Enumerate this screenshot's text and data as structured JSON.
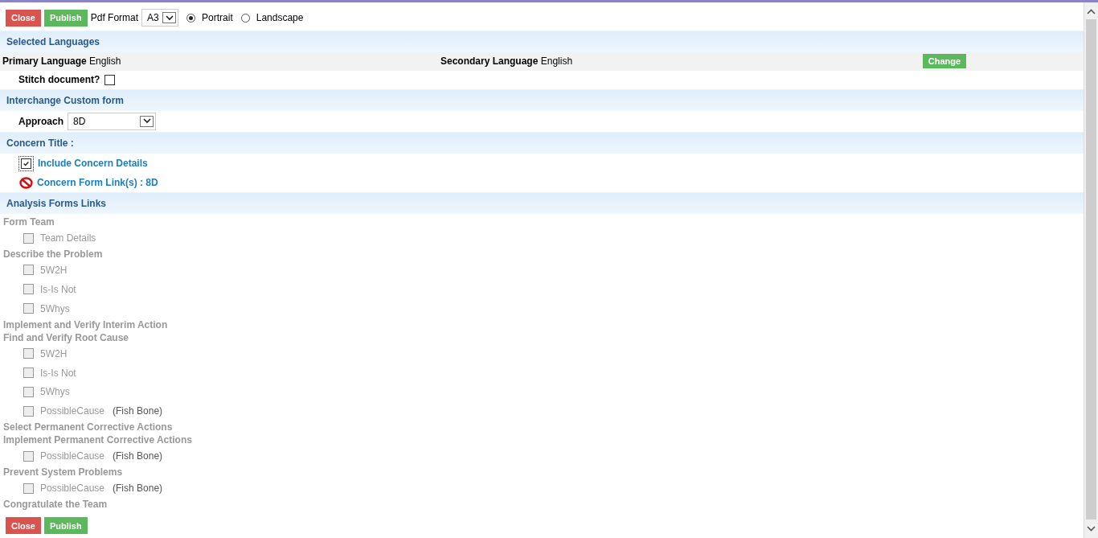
{
  "top_toolbar": {
    "buttons": [
      {
        "kind": "close",
        "label": "Close"
      },
      {
        "kind": "publish",
        "label": "Publish"
      }
    ],
    "pdf_format_label": "Pdf Format",
    "pdf_format_value": "A3",
    "orientation": [
      {
        "label": "Portrait",
        "selected": true
      },
      {
        "label": "Landscape",
        "selected": false
      }
    ]
  },
  "selected_languages": {
    "heading": "Selected Languages",
    "primary_label": "Primary Language",
    "primary_value": "English",
    "secondary_label": "Secondary Language",
    "secondary_value": "English",
    "change_button": "Change",
    "stitch_label": "Stitch document?",
    "stitch_checked": false
  },
  "interchange": {
    "heading": "Interchange Custom form",
    "approach_label": "Approach",
    "approach_value": "8D"
  },
  "concern": {
    "heading": "Concern Title :",
    "include_label": "Include Concern Details",
    "include_checked": true,
    "link_label": "Concern Form Link(s) : 8D"
  },
  "analysis": {
    "heading": "Analysis Forms Links",
    "groups": [
      {
        "title": "Form Team",
        "disabled": true,
        "items": [
          {
            "label": "Team Details",
            "checked": false
          }
        ]
      },
      {
        "title": "Describe the Problem",
        "disabled": true,
        "items": [
          {
            "label": "5W2H",
            "checked": false
          },
          {
            "label": "Is-Is Not",
            "checked": false
          },
          {
            "label": "5Whys",
            "checked": false
          }
        ]
      },
      {
        "title": "Implement and Verify Interim Action",
        "disabled": true
      },
      {
        "title": "Find and Verify Root Cause",
        "disabled": true,
        "items": [
          {
            "label": "5W2H",
            "checked": false
          },
          {
            "label": "Is-Is Not",
            "checked": false
          },
          {
            "label": "5Whys",
            "checked": false
          },
          {
            "label": "PossibleCause",
            "note": "(Fish Bone)",
            "checked": false
          }
        ]
      },
      {
        "title": "Select Permanent Corrective Actions",
        "disabled": true
      },
      {
        "title": "Implement Permanent Corrective Actions",
        "disabled": true,
        "items": [
          {
            "label": "PossibleCause",
            "note": "(Fish Bone)",
            "checked": false
          }
        ]
      },
      {
        "title": "Prevent System Problems",
        "disabled": true,
        "items": [
          {
            "label": "PossibleCause",
            "note": "(Fish Bone)",
            "checked": false
          }
        ]
      },
      {
        "title": "Congratulate the Team",
        "disabled": true
      }
    ]
  },
  "bottom_toolbar": {
    "buttons": [
      {
        "kind": "close",
        "label": "Close"
      },
      {
        "kind": "publish",
        "label": "Publish"
      }
    ]
  }
}
